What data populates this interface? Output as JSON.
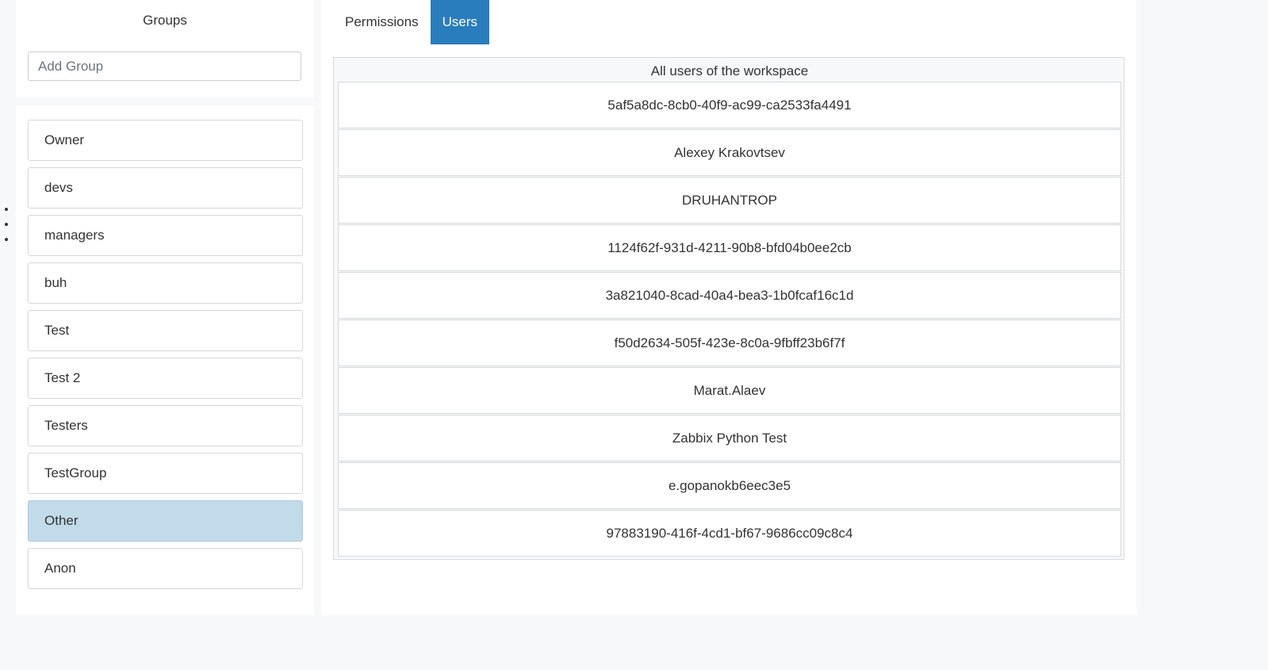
{
  "groups_panel": {
    "title": "Groups",
    "add_group_placeholder": "Add Group",
    "items": [
      {
        "label": "Owner"
      },
      {
        "label": "devs"
      },
      {
        "label": "managers"
      },
      {
        "label": "buh"
      },
      {
        "label": "Test"
      },
      {
        "label": "Test 2"
      },
      {
        "label": "Testers"
      },
      {
        "label": "TestGroup"
      },
      {
        "label": "Other",
        "selected": true
      },
      {
        "label": "Anon"
      }
    ]
  },
  "tabs": [
    {
      "label": "Permissions",
      "active": false
    },
    {
      "label": "Users",
      "active": true
    }
  ],
  "users_panel": {
    "caption": "All users of the workspace",
    "users": [
      "5af5a8dc-8cb0-40f9-ac99-ca2533fa4491",
      "Alexey Krakovtsev",
      "DRUHANTROP",
      "1124f62f-931d-4211-90b8-bfd04b0ee2cb",
      "3a821040-8cad-40a4-bea3-1b0fcaf16c1d",
      "f50d2634-505f-423e-8c0a-9fbff23b6f7f",
      "Marat.Alaev",
      "Zabbix Python Test",
      "e.gopanokb6eec3e5",
      "97883190-416f-4cd1-bf67-9686cc09c8c4"
    ]
  },
  "colors": {
    "accent": "#2a7dbd",
    "selected_group": "#c2dbea",
    "page_background": "#f6f8fa"
  }
}
